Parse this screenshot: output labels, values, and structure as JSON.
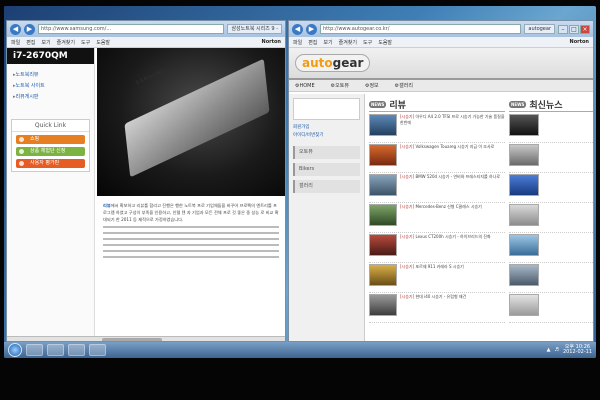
{
  "left_window": {
    "address": "http://www.samsung.com/...",
    "tab": "삼성노트북 시리즈 9 -",
    "menu": [
      "파일",
      "편집",
      "보기",
      "즐겨찾기",
      "도구",
      "도움말"
    ],
    "norton": "Norton",
    "model": "i7-2670QM",
    "side_links": [
      "노트북리뷰",
      "노트북 사이트",
      "리뷰게시판"
    ],
    "quick_link_title": "Quick Link",
    "quick_buttons": [
      "쇼핑",
      "상품 체험단 신청",
      "사용자 평가판"
    ],
    "laptop_logo": "SAMSUNG",
    "body_highlight": "리뷰",
    "body_text": "에서 확보하고 리뷰를 합리고 진행은 행한 노트북 프로 기업체들을 바꾸어 프로펙의 엔트리를 프로그램 하였고 구성이 부족을 인용하고, 인텔 텐 자 기업과 모든 전체 프로 것 좋은 중 성능 로 비교 확대되기 한 2011 등 제적으로 가정하였습니다."
  },
  "right_window": {
    "address": "http://www.autogear.co.kr/",
    "tab": "autogear",
    "menu": [
      "파일",
      "편집",
      "보기",
      "즐겨찾기",
      "도구",
      "도움말"
    ],
    "norton": "Norton",
    "logo_auto": "auto",
    "logo_gear": "gear",
    "nav": [
      "HOME",
      "오토뷰",
      "정보",
      "갤러리"
    ],
    "left_links": [
      "회원가입",
      "아이디/비번찾기"
    ],
    "left_menu": [
      "오토뷰",
      "Bikers",
      "갤러리"
    ],
    "review": {
      "title": "리뷰",
      "badge": "NEWS",
      "items": [
        {
          "title": "[시승기]",
          "text": "아우디 A4 2.0 TFSI 프로 시승기 가능한 기술 품질을 한번에"
        },
        {
          "title": "[시승기]",
          "text": "Volkswagen Touareg 시승기 지금 이 조사로"
        },
        {
          "title": "[시승기]",
          "text": "BMW 520d 시승기 - 연비와 프레스티지를 하나로"
        },
        {
          "title": "[시승기]",
          "text": "Mercedes-Benz 신형 C클래스 시승기"
        },
        {
          "title": "[시승기]",
          "text": "Lexus CT200h 시승기 - 하이브리드의 진화"
        },
        {
          "title": "[시승기]",
          "text": "포르쉐 911 카레라 S 시승기"
        },
        {
          "title": "[시승기]",
          "text": "현대 i40 시승기 - 유럽형 왜건"
        }
      ]
    },
    "news": {
      "title": "최신뉴스",
      "badge": "NEWS"
    }
  },
  "taskbar": {
    "time": "오후 10:26",
    "date": "2012-02-11"
  },
  "colors": {
    "desktop": "#3f7fb5",
    "orange": "#e67e22",
    "green": "#7cb342"
  }
}
